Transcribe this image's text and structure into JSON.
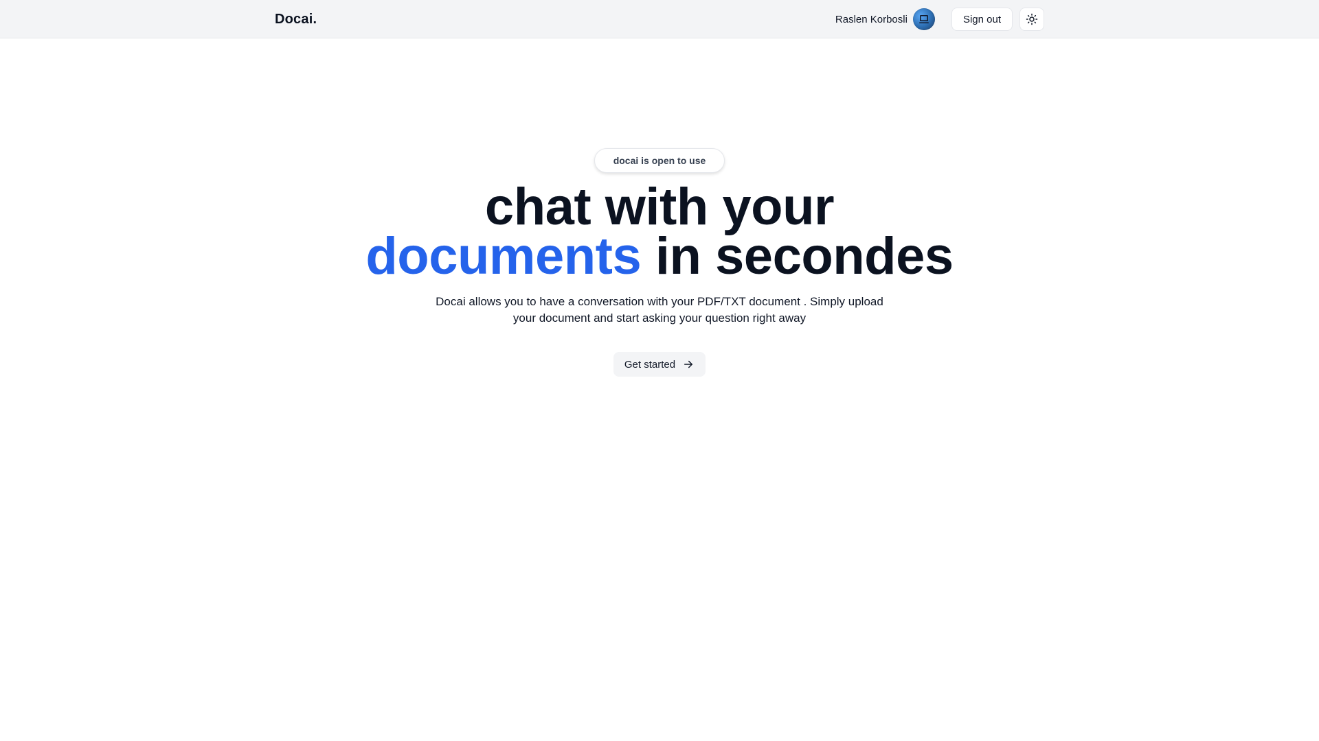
{
  "header": {
    "brand": "Docai.",
    "user_name": "Raslen Korbosli",
    "avatar_icon": "laptop-icon",
    "sign_out_label": "Sign out",
    "theme_toggle_icon": "sun-icon"
  },
  "hero": {
    "badge": "docai is open to use",
    "headline_line1": "chat with your",
    "headline_accent": "documents",
    "headline_rest": "in secondes",
    "subtitle": "Docai allows you to have a conversation with your PDF/TXT document . Simply upload your document and start asking your question right away",
    "cta_label": "Get started",
    "cta_icon": "arrow-right-icon"
  },
  "colors": {
    "accent": "#2563eb",
    "header_bg": "#f3f4f6",
    "text": "#0b1220"
  }
}
